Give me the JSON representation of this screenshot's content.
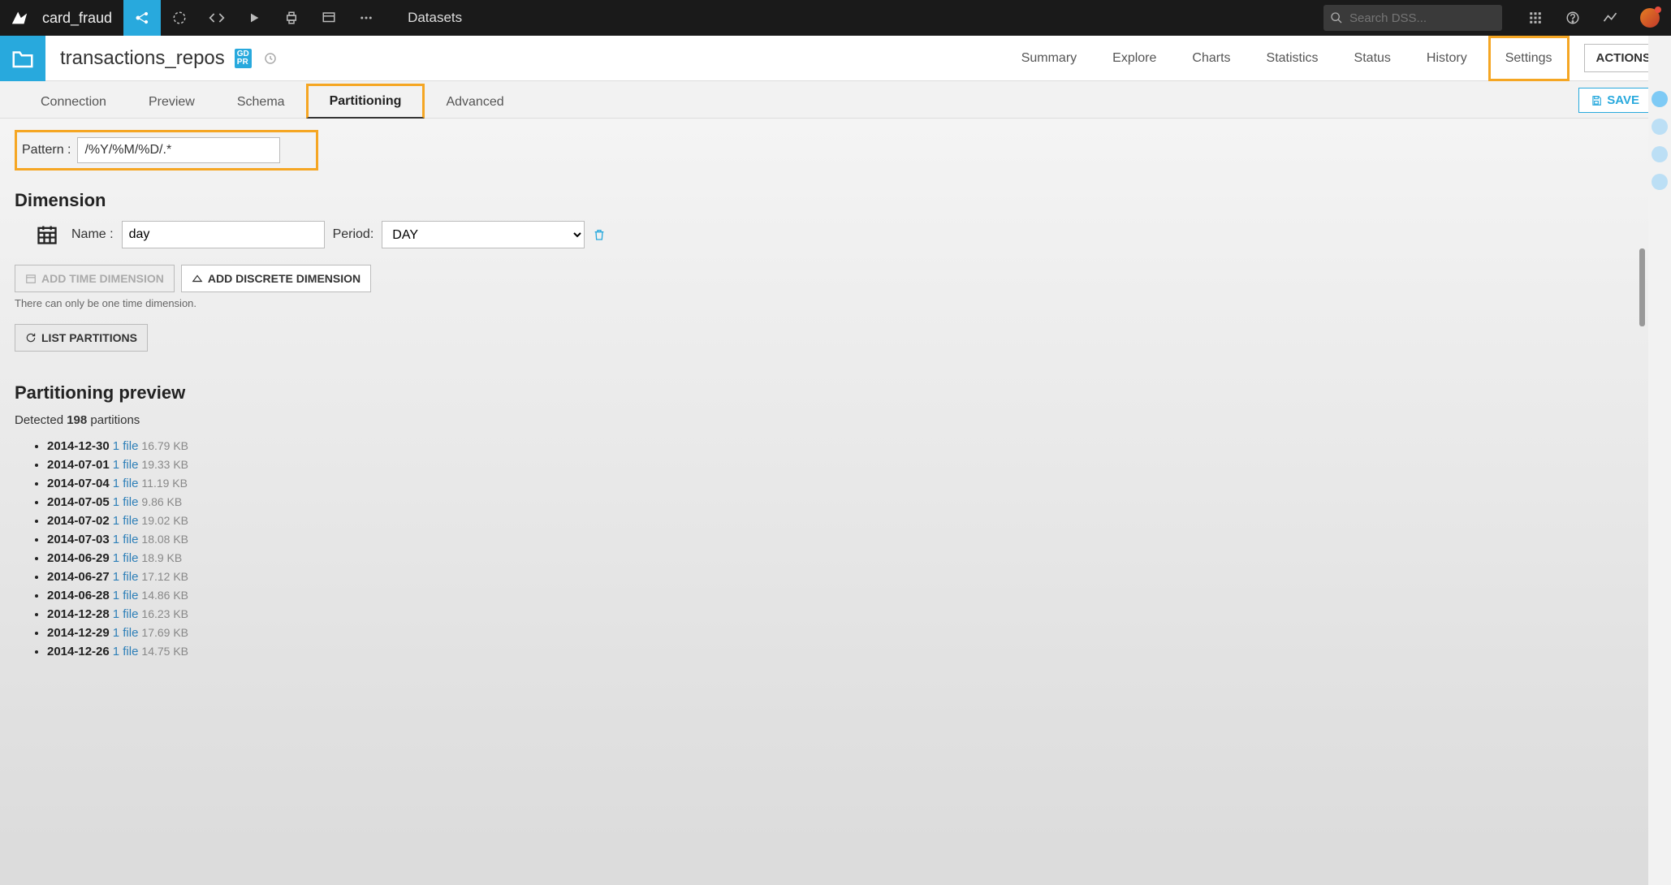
{
  "topbar": {
    "project": "card_fraud",
    "section": "Datasets",
    "search_placeholder": "Search DSS..."
  },
  "header": {
    "dataset_name": "transactions_repos",
    "gdpr_badge": "GD\nPR",
    "tabs": [
      "Summary",
      "Explore",
      "Charts",
      "Statistics",
      "Status",
      "History",
      "Settings"
    ],
    "active_tab": "Settings",
    "actions_label": "ACTIONS"
  },
  "subtabs": {
    "items": [
      "Connection",
      "Preview",
      "Schema",
      "Partitioning",
      "Advanced"
    ],
    "active": "Partitioning",
    "save_label": "SAVE"
  },
  "pattern": {
    "label": "Pattern :",
    "value": "/%Y/%M/%D/.*"
  },
  "dimension": {
    "heading": "Dimension",
    "name_label": "Name :",
    "name_value": "day",
    "period_label": "Period:",
    "period_value": "DAY"
  },
  "buttons": {
    "add_time": "ADD TIME DIMENSION",
    "add_discrete": "ADD DISCRETE DIMENSION",
    "hint": "There can only be one time dimension.",
    "list_partitions": "LIST PARTITIONS"
  },
  "preview": {
    "heading": "Partitioning preview",
    "detected_prefix": "Detected ",
    "detected_count": "198",
    "detected_suffix": " partitions",
    "file_link": "1 file",
    "partitions": [
      {
        "date": "2014-12-30",
        "size": "16.79 KB"
      },
      {
        "date": "2014-07-01",
        "size": "19.33 KB"
      },
      {
        "date": "2014-07-04",
        "size": "11.19 KB"
      },
      {
        "date": "2014-07-05",
        "size": "9.86 KB"
      },
      {
        "date": "2014-07-02",
        "size": "19.02 KB"
      },
      {
        "date": "2014-07-03",
        "size": "18.08 KB"
      },
      {
        "date": "2014-06-29",
        "size": "18.9 KB"
      },
      {
        "date": "2014-06-27",
        "size": "17.12 KB"
      },
      {
        "date": "2014-06-28",
        "size": "14.86 KB"
      },
      {
        "date": "2014-12-28",
        "size": "16.23 KB"
      },
      {
        "date": "2014-12-29",
        "size": "17.69 KB"
      },
      {
        "date": "2014-12-26",
        "size": "14.75 KB"
      }
    ]
  }
}
